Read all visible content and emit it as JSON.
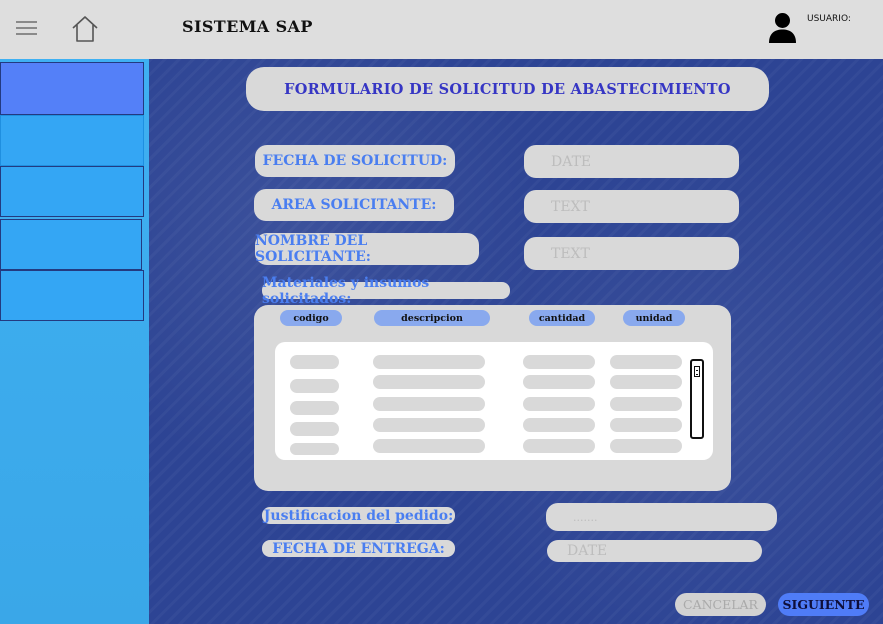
{
  "header": {
    "title": "SISTEMA SAP",
    "user_label": "USUARIO:",
    "icons": {
      "menu": "hamburger-menu-icon",
      "home": "home-icon",
      "user": "user-icon"
    }
  },
  "sidebar": {
    "items": [
      {
        "label": "",
        "color": "#5480f8"
      },
      {
        "label": "",
        "color": "#34a6f4"
      },
      {
        "label": "",
        "color": "#34a6f4"
      },
      {
        "label": "",
        "color": "#34a6f4"
      },
      {
        "label": "",
        "color": "#34a6f4"
      }
    ]
  },
  "form": {
    "title": "FORMULARIO DE SOLICITUD DE ABASTECIMIENTO",
    "fields": [
      {
        "label": "FECHA DE SOLICITUD:",
        "placeholder": "DATE"
      },
      {
        "label": "AREA SOLICITANTE:",
        "placeholder": "TEXT"
      },
      {
        "label": "NOMBRE DEL SOLICITANTE:",
        "placeholder": "TEXT"
      }
    ],
    "materials": {
      "label": "Materiales y insumos solicitados:",
      "columns": [
        "codigo",
        "descripcion",
        "cantidad",
        "unidad"
      ],
      "row_count": 5
    },
    "justification": {
      "label": "Justificacion del pedido:",
      "placeholder": "......."
    },
    "delivery_date": {
      "label": "FECHA DE ENTREGA:",
      "placeholder": "DATE"
    }
  },
  "actions": {
    "cancel_label": "CANCELAR",
    "next_label": "SIGUIENTE"
  },
  "colors": {
    "topbar": "#dedede",
    "sidebar": "#3aa9ee",
    "main_background": "#2d4494",
    "field_background": "#d9d9d9",
    "label_text": "#4a7ef0",
    "title_text": "#3636c4",
    "column_header": "#89a9ee",
    "primary_button": "#4f7cf7"
  }
}
